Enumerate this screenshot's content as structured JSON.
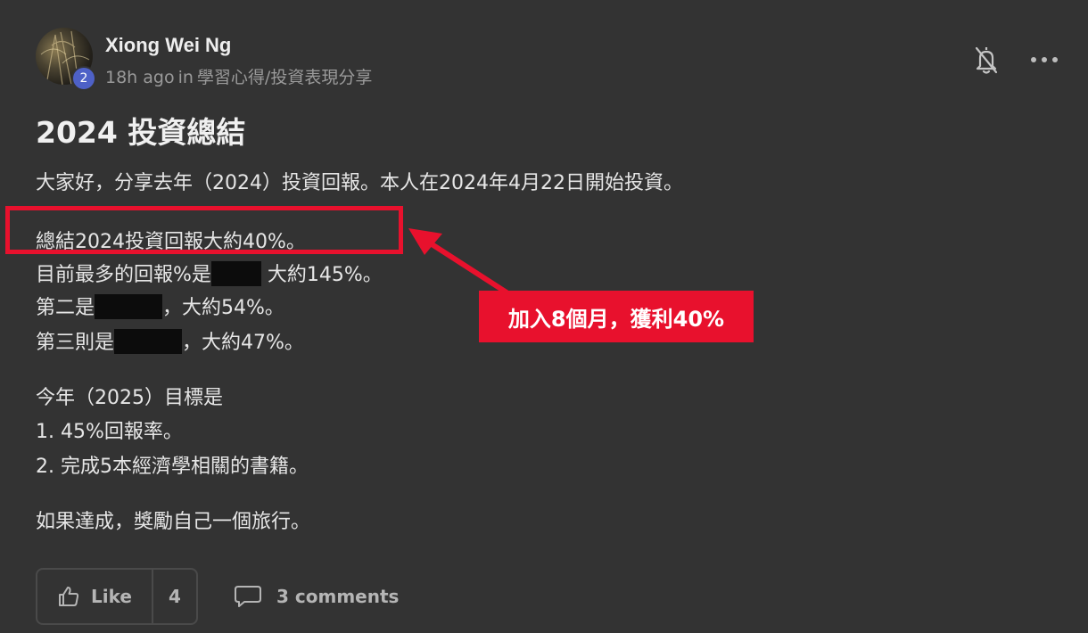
{
  "post": {
    "author": "Xiong Wei Ng",
    "level": "2",
    "time": "18h ago",
    "in_label": "in",
    "category": "學習心得/投資表現分享",
    "title": "2024 投資總結"
  },
  "body": {
    "intro": "大家好，分享去年（2024）投資回報。本人在2024年4月22日開始投資。",
    "summary": "總結2024投資回報大約40%。",
    "top_prefix": "目前最多的回報%是",
    "top_suffix": "大約145%。",
    "second_prefix": "第二是",
    "second_suffix": "，大約54%。",
    "third_prefix": "第三則是",
    "third_suffix": "，大約47%。",
    "goal_heading": "今年（2025）目標是",
    "goal_1": "1. 45%回報率。",
    "goal_2": "2. 完成5本經濟學相關的書籍。",
    "closing": "如果達成，獎勵自己一個旅行。"
  },
  "annotation": {
    "callout": "加入8個月，獲利40%",
    "color": "#e8112d"
  },
  "actions": {
    "like_label": "Like",
    "like_count": "4",
    "comments_label": "3 comments"
  },
  "icons": {
    "bell": "bell-off-icon",
    "more": "more-dots-icon",
    "like": "thumbs-up-icon",
    "comment": "comment-bubble-icon"
  }
}
